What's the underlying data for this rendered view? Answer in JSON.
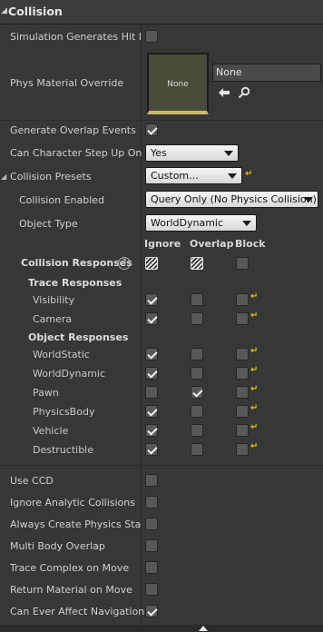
{
  "header": {
    "title": "Collision"
  },
  "rows": {
    "sim_hit": "Simulation Generates Hit Events",
    "phys_mat": "Phys Material Override",
    "overlap_events": "Generate Overlap Events",
    "step_up": "Can Character Step Up On",
    "presets": "Collision Presets",
    "collision_enabled": "Collision Enabled",
    "object_type": "Object Type",
    "responses": "Collision Responses",
    "trace_responses": "Trace Responses",
    "object_responses": "Object Responses",
    "use_ccd": "Use CCD",
    "ignore_analytic": "Ignore Analytic Collisions",
    "always_create": "Always Create Physics State",
    "multi_body": "Multi Body Overlap",
    "trace_complex": "Trace Complex on Move",
    "return_material": "Return Material on Move",
    "affect_nav": "Can Ever Affect Navigation"
  },
  "phys_material": {
    "thumb_label": "None",
    "name": "None"
  },
  "dropdowns": {
    "step_up": "Yes",
    "presets": "Custom...",
    "collision_enabled": "Query Only (No Physics Collision)",
    "object_type": "WorldDynamic"
  },
  "columns": {
    "ignore": "Ignore",
    "overlap": "Overlap",
    "block": "Block"
  },
  "trace_channels": [
    "Visibility",
    "Camera"
  ],
  "object_channels": [
    "WorldStatic",
    "WorldDynamic",
    "Pawn",
    "PhysicsBody",
    "Vehicle",
    "Destructible"
  ],
  "checkbox_states": {
    "sim_hit": false,
    "overlap_events": true,
    "use_ccd": false,
    "ignore_analytic": false,
    "always_create": false,
    "multi_body": false,
    "trace_complex": false,
    "return_material": false,
    "affect_nav": true
  },
  "colors": {
    "reset_arrow": "#e8c000",
    "material_accent": "#c9b86b"
  },
  "icons": [
    "collapse-arrow-icon",
    "use-selected-arrow-icon",
    "browse-magnifier-icon",
    "reset-to-default-icon",
    "help-icon"
  ]
}
